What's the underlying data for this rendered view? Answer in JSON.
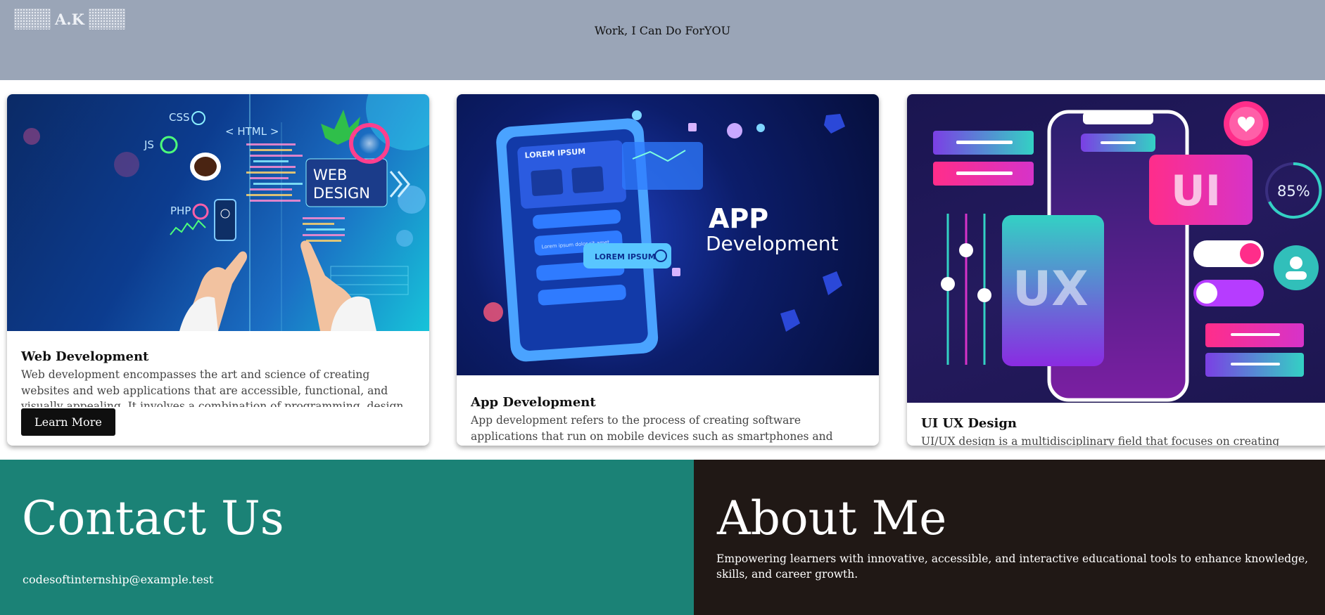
{
  "header": {
    "logo_text": "A.K",
    "headline_lead": "Work, I Can Do For",
    "headline_emphasis": "YOU"
  },
  "cards": [
    {
      "title": "Web Development",
      "description": "Web development encompasses the art and science of creating websites and web applications that are accessible, functional, and visually appealing. It involves a combination of programming, design,",
      "button_label": "Learn More",
      "image_text": {
        "css": "CSS",
        "html": "< HTML >",
        "js": "JS",
        "php": "PHP",
        "web": "WEB",
        "design": "DESIGN"
      }
    },
    {
      "title": "App Development",
      "description": "App development refers to the process of creating software applications that run on mobile devices such as smartphones and tablets. It involves",
      "image_text": {
        "app": "APP",
        "development": "Development",
        "lorem_header": "LOREM IPSUM",
        "lorem_button": "LOREM IPSUM",
        "lorem_line": "Lorem ipsum dolor sit amet"
      }
    },
    {
      "title": "UI UX Design",
      "description": "UI/UX design is a multidisciplinary field that focuses on creating intuitive,",
      "image_text": {
        "ui": "UI",
        "ux": "UX",
        "percent": "85%"
      }
    }
  ],
  "contact": {
    "title": "Contact Us",
    "email": "codesoftinternship@example.test"
  },
  "about": {
    "title": "About Me",
    "description": "Empowering learners with innovative, accessible, and interactive educational tools to enhance knowledge, skills, and career growth."
  },
  "colors": {
    "header_bg": "#9aa5b7",
    "contact_bg": "#1b8276",
    "about_bg": "#201815",
    "button_bg": "#0f0f0f"
  }
}
